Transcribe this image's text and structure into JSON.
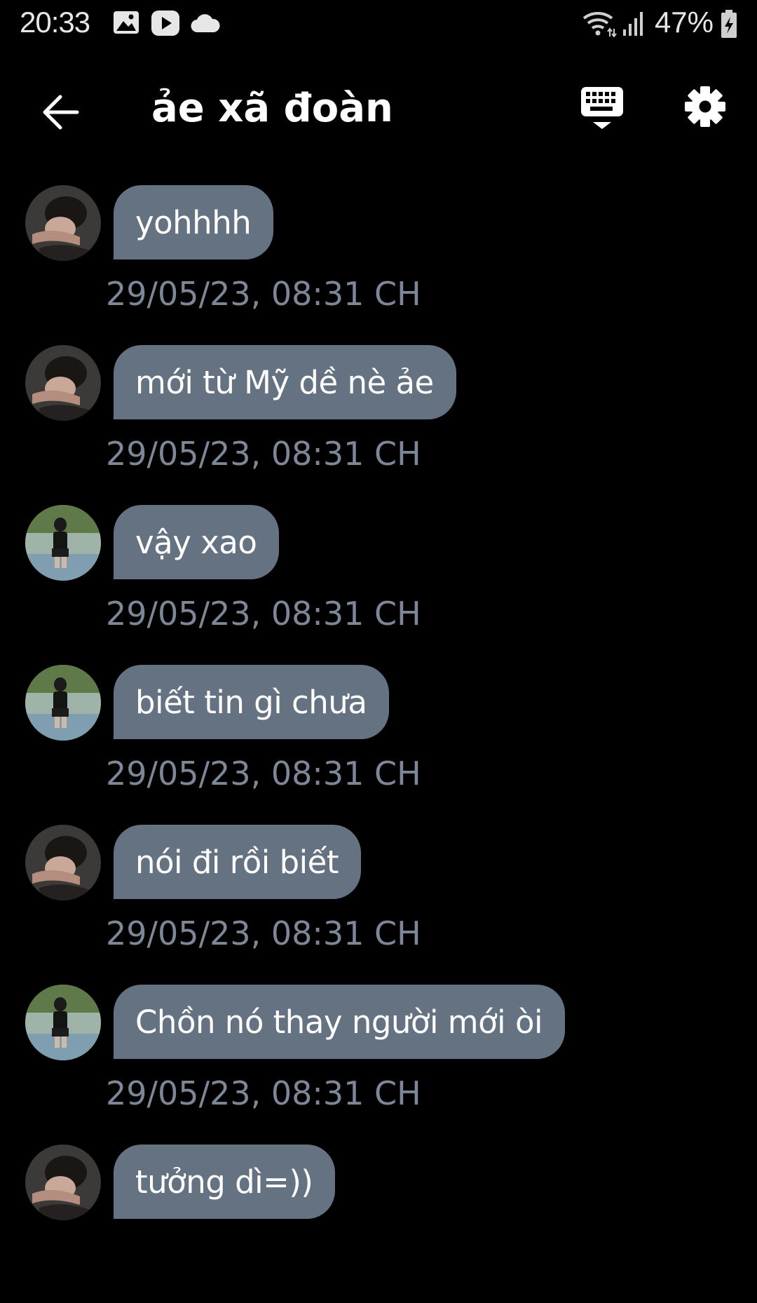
{
  "status_bar": {
    "time": "20:33",
    "battery": "47%",
    "icons": [
      "image-icon",
      "play-icon",
      "cloud-icon",
      "wifi-icon",
      "signal-icon",
      "battery-charging-icon"
    ]
  },
  "header": {
    "back_icon": "arrow-left-icon",
    "title": "ảe xã đoàn",
    "keyboard_icon": "keyboard-icon",
    "settings_icon": "gear-icon"
  },
  "colors": {
    "background": "#000000",
    "bubble": "#657282",
    "timestamp": "#7d8797",
    "text": "#ffffff"
  },
  "messages": [
    {
      "sender_avatar": "avatar-a",
      "text": "yohhhh",
      "time": "29/05/23, 08:31 CH"
    },
    {
      "sender_avatar": "avatar-a",
      "text": "mới từ Mỹ dề nè ảe",
      "time": "29/05/23, 08:31 CH"
    },
    {
      "sender_avatar": "avatar-b",
      "text": "vậy xao",
      "time": "29/05/23, 08:31 CH"
    },
    {
      "sender_avatar": "avatar-b",
      "text": "biết tin gì chưa",
      "time": "29/05/23, 08:31 CH"
    },
    {
      "sender_avatar": "avatar-a",
      "text": "nói đi rồi biết",
      "time": "29/05/23, 08:31 CH"
    },
    {
      "sender_avatar": "avatar-b",
      "text": "Chồn nó thay người mới òi",
      "time": "29/05/23, 08:31 CH"
    },
    {
      "sender_avatar": "avatar-a",
      "text": "tưởng dì=))",
      "time": ""
    }
  ]
}
